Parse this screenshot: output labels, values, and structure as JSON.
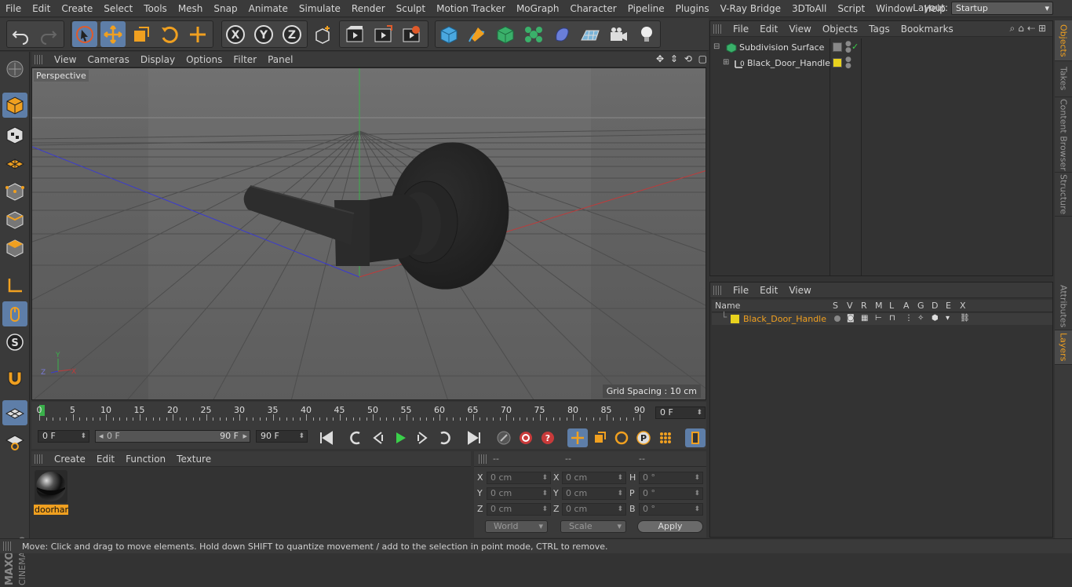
{
  "menu": [
    "File",
    "Edit",
    "Create",
    "Select",
    "Tools",
    "Mesh",
    "Snap",
    "Animate",
    "Simulate",
    "Render",
    "Sculpt",
    "Motion Tracker",
    "MoGraph",
    "Character",
    "Pipeline",
    "Plugins",
    "V-Ray Bridge",
    "3DToAll",
    "Script",
    "Window",
    "Help"
  ],
  "layout": {
    "label": "Layout:",
    "value": "Startup"
  },
  "viewport": {
    "menu": [
      "View",
      "Cameras",
      "Display",
      "Options",
      "Filter",
      "Panel"
    ],
    "label": "Perspective",
    "grid_spacing": "Grid Spacing : 10 cm"
  },
  "timeline": {
    "ticks": [
      "0",
      "5",
      "10",
      "15",
      "20",
      "25",
      "30",
      "35",
      "40",
      "45",
      "50",
      "55",
      "60",
      "65",
      "70",
      "75",
      "80",
      "85",
      "90"
    ],
    "current_frame": "0 F"
  },
  "transport": {
    "start": "0 F",
    "range_start": "0 F",
    "range_end": "90 F",
    "end": "90 F"
  },
  "material_menu": [
    "Create",
    "Edit",
    "Function",
    "Texture"
  ],
  "material": {
    "name": "doorhan"
  },
  "coords": {
    "header": [
      "--",
      "--",
      "--"
    ],
    "rows": [
      {
        "a_lab": "X",
        "a": "0 cm",
        "b_lab": "X",
        "b": "0 cm",
        "c_lab": "H",
        "c": "0 °"
      },
      {
        "a_lab": "Y",
        "a": "0 cm",
        "b_lab": "Y",
        "b": "0 cm",
        "c_lab": "P",
        "c": "0 °"
      },
      {
        "a_lab": "Z",
        "a": "0 cm",
        "b_lab": "Z",
        "b": "0 cm",
        "c_lab": "B",
        "c": "0 °"
      }
    ],
    "world": "World",
    "scale": "Scale",
    "apply": "Apply"
  },
  "objects": {
    "menu": [
      "File",
      "Edit",
      "View",
      "Objects",
      "Tags",
      "Bookmarks"
    ],
    "items": [
      {
        "name": "Subdivision Surface"
      },
      {
        "name": "Black_Door_Handle"
      }
    ]
  },
  "layers": {
    "menu": [
      "File",
      "Edit",
      "View"
    ],
    "columns": {
      "name": "Name",
      "flags": [
        "S",
        "V",
        "R",
        "M",
        "L",
        "A",
        "G",
        "D",
        "E",
        "X"
      ]
    },
    "items": [
      {
        "name": "Black_Door_Handle",
        "color": "#e8d21e"
      }
    ]
  },
  "side_tabs": [
    "Objects",
    "Takes",
    "Content Browser",
    "Structure",
    "Attributes",
    "Layers"
  ],
  "status": "Move: Click and drag to move elements. Hold down SHIFT to quantize movement / add to the selection in point mode, CTRL to remove.",
  "colors": {
    "accent": "#5e7ea8",
    "highlight": "#f0a020"
  },
  "brand": {
    "logo": "MAXON CINEMA 4D"
  }
}
